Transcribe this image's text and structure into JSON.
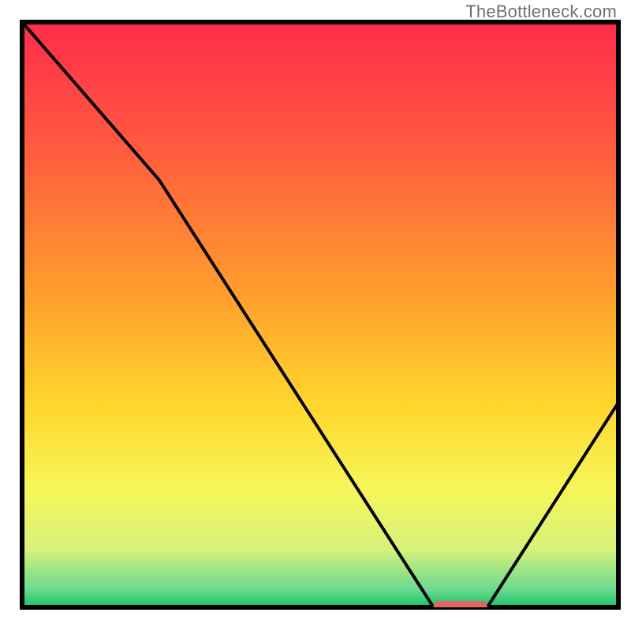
{
  "watermark": "TheBottleneck.com",
  "chart_data": {
    "type": "line",
    "title": "",
    "xlabel": "",
    "ylabel": "",
    "xlim": [
      0,
      100
    ],
    "ylim": [
      0,
      100
    ],
    "grid": false,
    "legend_position": "none",
    "series": [
      {
        "name": "curve",
        "x": [
          0,
          23,
          69,
          78,
          100
        ],
        "y": [
          100,
          73,
          0,
          0,
          35
        ]
      }
    ],
    "marker": {
      "name": "optimal-region",
      "x_start": 69,
      "x_end": 78,
      "y": 0,
      "color": "#e06666"
    },
    "gradient_stops": [
      {
        "pos": 0.0,
        "color": "#ff2b4b"
      },
      {
        "pos": 0.2,
        "color": "#ff5740"
      },
      {
        "pos": 0.45,
        "color": "#ff9a2d"
      },
      {
        "pos": 0.65,
        "color": "#ffd52c"
      },
      {
        "pos": 0.8,
        "color": "#f6f65a"
      },
      {
        "pos": 0.9,
        "color": "#d6f27a"
      },
      {
        "pos": 0.97,
        "color": "#6ad98f"
      },
      {
        "pos": 1.0,
        "color": "#15c264"
      }
    ],
    "annotations": []
  }
}
